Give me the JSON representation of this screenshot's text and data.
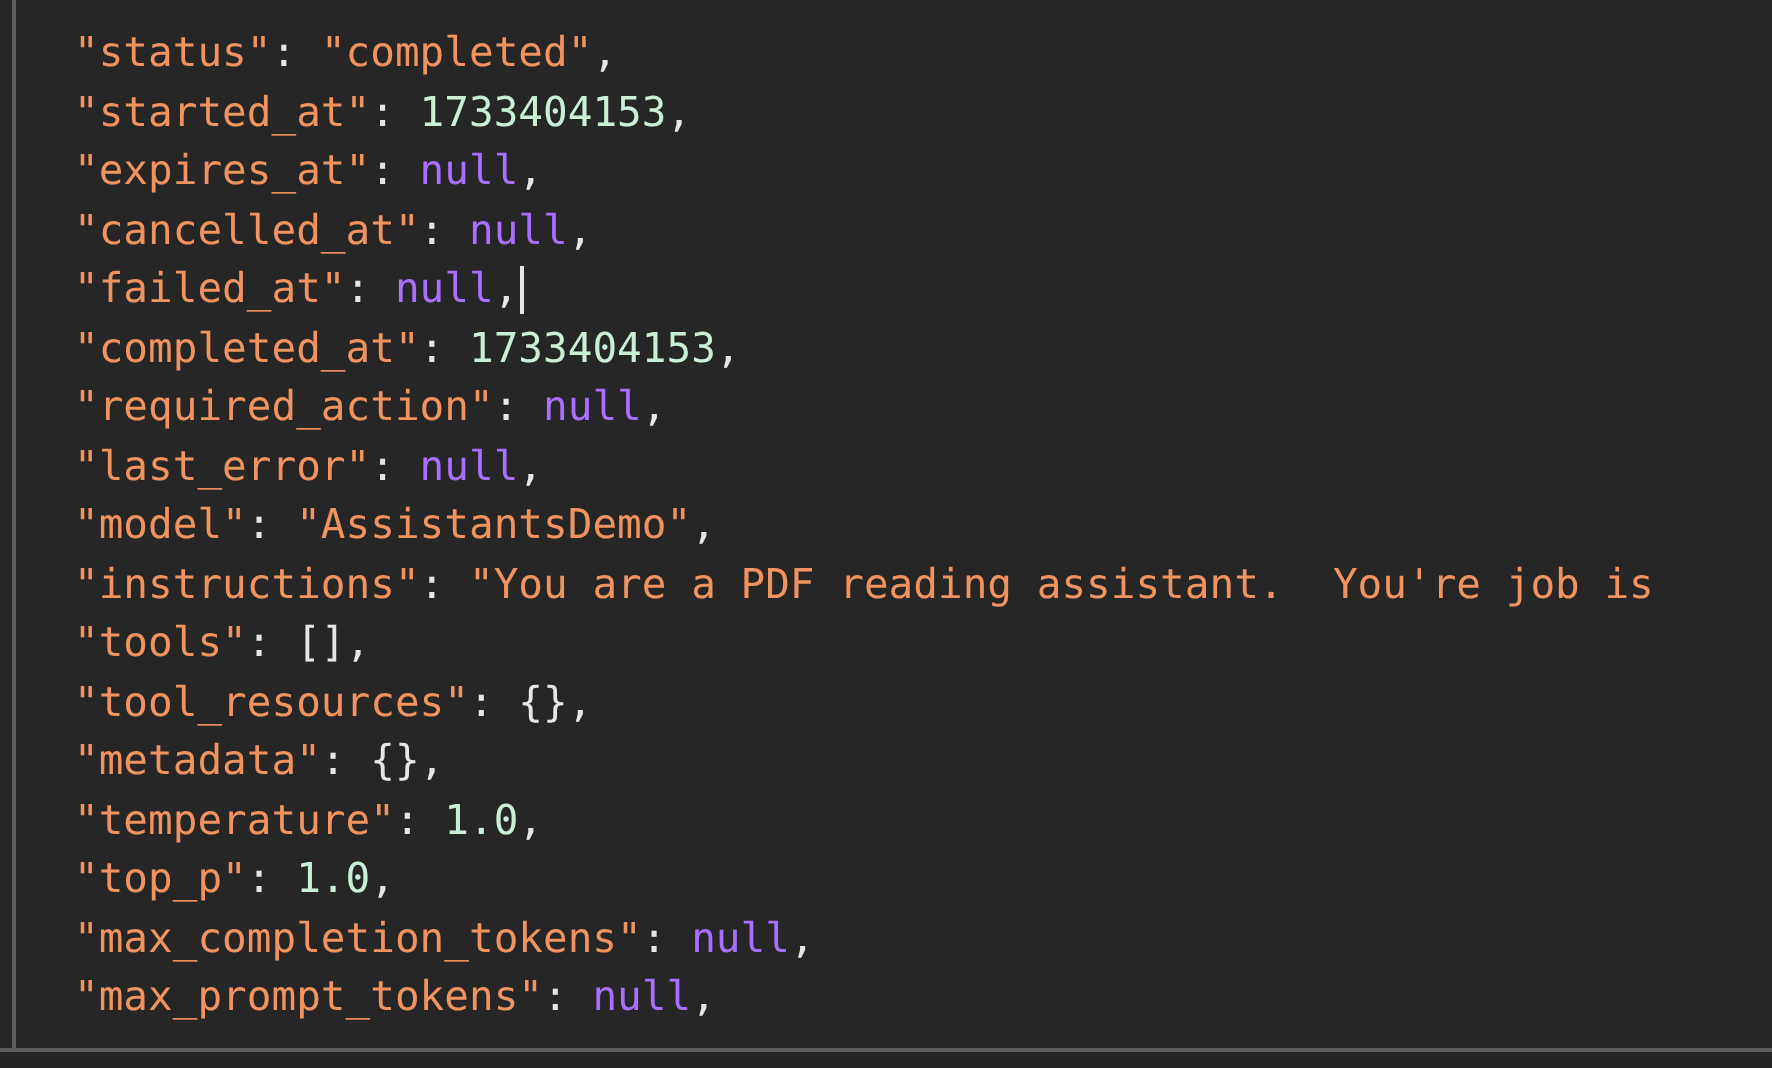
{
  "editor": {
    "lines": [
      {
        "key": "\"status\"",
        "colon": ": ",
        "value": "\"completed\"",
        "kind": "string",
        "end": ",",
        "cursor": false
      },
      {
        "key": "\"started_at\"",
        "colon": ": ",
        "value": "1733404153",
        "kind": "number",
        "end": ",",
        "cursor": false
      },
      {
        "key": "\"expires_at\"",
        "colon": ": ",
        "value": "null",
        "kind": "null",
        "end": ",",
        "cursor": false
      },
      {
        "key": "\"cancelled_at\"",
        "colon": ": ",
        "value": "null",
        "kind": "null",
        "end": ",",
        "cursor": false
      },
      {
        "key": "\"failed_at\"",
        "colon": ": ",
        "value": "null",
        "kind": "null",
        "end": ",",
        "cursor": true
      },
      {
        "key": "\"completed_at\"",
        "colon": ": ",
        "value": "1733404153",
        "kind": "number",
        "end": ",",
        "cursor": false
      },
      {
        "key": "\"required_action\"",
        "colon": ": ",
        "value": "null",
        "kind": "null",
        "end": ",",
        "cursor": false
      },
      {
        "key": "\"last_error\"",
        "colon": ": ",
        "value": "null",
        "kind": "null",
        "end": ",",
        "cursor": false
      },
      {
        "key": "\"model\"",
        "colon": ": ",
        "value": "\"AssistantsDemo\"",
        "kind": "string",
        "end": ",",
        "cursor": false
      },
      {
        "key": "\"instructions\"",
        "colon": ": ",
        "value": "\"You are a PDF reading assistant.  You're job is",
        "kind": "string",
        "cursor": false
      },
      {
        "key": "\"tools\"",
        "colon": ": ",
        "value": "[]",
        "kind": "plain",
        "end": ",",
        "cursor": false
      },
      {
        "key": "\"tool_resources\"",
        "colon": ": ",
        "value": "{}",
        "kind": "plain",
        "end": ",",
        "cursor": false
      },
      {
        "key": "\"metadata\"",
        "colon": ": ",
        "value": "{}",
        "kind": "plain",
        "end": ",",
        "cursor": false
      },
      {
        "key": "\"temperature\"",
        "colon": ": ",
        "value": "1.0",
        "kind": "number",
        "end": ",",
        "cursor": false
      },
      {
        "key": "\"top_p\"",
        "colon": ": ",
        "value": "1.0",
        "kind": "number",
        "end": ",",
        "cursor": false
      },
      {
        "key": "\"max_completion_tokens\"",
        "colon": ": ",
        "value": "null",
        "kind": "null",
        "end": ",",
        "cursor": false
      },
      {
        "key": "\"max_prompt_tokens\"",
        "colon": ": ",
        "value": "null",
        "kind": "null",
        "end": ",",
        "cursor": false
      }
    ]
  }
}
